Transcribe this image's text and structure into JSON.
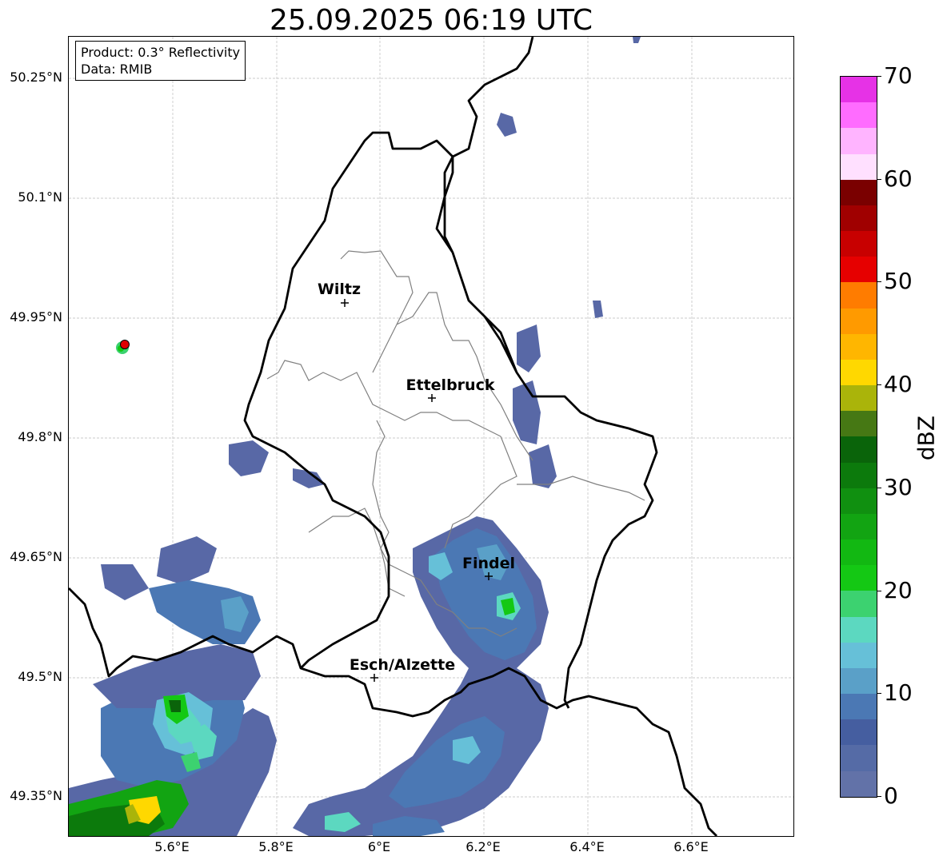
{
  "title": "25.09.2025 06:19 UTC",
  "product_box": {
    "product": "Product: 0.3° Reflectivity",
    "data": "Data: RMIB"
  },
  "axes": {
    "y_ticks": [
      "50.25°N",
      "50.1°N",
      "49.95°N",
      "49.8°N",
      "49.65°N",
      "49.5°N",
      "49.35°N"
    ],
    "x_ticks": [
      "5.6°E",
      "5.8°E",
      "6°E",
      "6.2°E",
      "6.4°E",
      "6.6°E"
    ],
    "gridlines": true
  },
  "cities": [
    {
      "name": "Wiltz"
    },
    {
      "name": "Ettelbruck"
    },
    {
      "name": "Findel"
    },
    {
      "name": "Esch/Alzette"
    }
  ],
  "radar_site_marker": {
    "color": "#e00000"
  },
  "colorbar": {
    "title": "dBZ",
    "tick_labels": [
      "0",
      "10",
      "20",
      "30",
      "40",
      "50",
      "60",
      "70"
    ],
    "colors_bottom_to_top": [
      "#6272a8",
      "#556ba6",
      "#455ea0",
      "#4b78b4",
      "#5aa0c8",
      "#66c0d8",
      "#5cd8c0",
      "#3cd270",
      "#14c814",
      "#12b812",
      "#12a412",
      "#109010",
      "#0c7a0c",
      "#0a640a",
      "#467814",
      "#aab40a",
      "#ffd800",
      "#ffb600",
      "#ff9a00",
      "#ff7c00",
      "#e60000",
      "#c80000",
      "#a00000",
      "#7a0000",
      "#ffe0ff",
      "#ffb4ff",
      "#ff6cff",
      "#e632e6"
    ]
  }
}
